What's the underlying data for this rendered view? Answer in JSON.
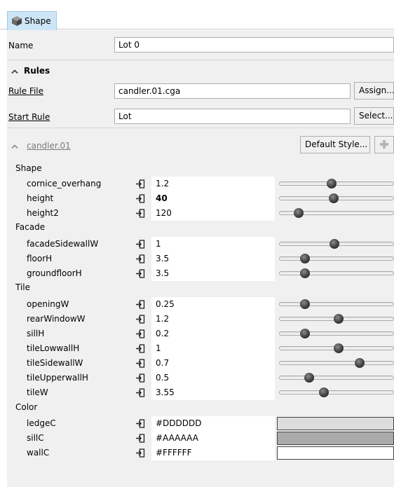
{
  "tab": {
    "label": "Shape"
  },
  "name_row": {
    "label": "Name",
    "value": "Lot 0"
  },
  "rules": {
    "title": "Rules",
    "rule_file_label": "Rule File",
    "rule_file_value": "candler.01.cga",
    "assign_label": "Assign...",
    "start_rule_label": "Start Rule",
    "start_rule_value": "Lot",
    "select_label": "Select..."
  },
  "cga": {
    "title": "candler.01",
    "default_style_label": "Default Style...",
    "add_icon": "plus-icon"
  },
  "groups": [
    {
      "name": "Shape"
    },
    {
      "name": "Facade"
    },
    {
      "name": "Tile"
    },
    {
      "name": "Color"
    }
  ],
  "attributes": {
    "cornice_overhang": {
      "name": "cornice_overhang",
      "value": "1.2",
      "level": 0.45
    },
    "height": {
      "name": "height",
      "value": "40",
      "level": 0.47
    },
    "height2": {
      "name": "height2",
      "value": "120",
      "level": 0.14
    },
    "facadeSidewallW": {
      "name": "facadeSidewallW",
      "value": "1",
      "level": 0.48
    },
    "floorH": {
      "name": "floorH",
      "value": "3.5",
      "level": 0.2
    },
    "groundfloorH": {
      "name": "groundfloorH",
      "value": "3.5",
      "level": 0.2
    },
    "openingW": {
      "name": "openingW",
      "value": "0.25",
      "level": 0.2
    },
    "rearWindowW": {
      "name": "rearWindowW",
      "value": "1.2",
      "level": 0.52
    },
    "sillH": {
      "name": "sillH",
      "value": "0.2",
      "level": 0.2
    },
    "tileLowwallH": {
      "name": "tileLowwallH",
      "value": "1",
      "level": 0.52
    },
    "tileSidewallW": {
      "name": "tileSidewallW",
      "value": "0.7",
      "level": 0.72
    },
    "tileUpperwallH": {
      "name": "tileUpperwallH",
      "value": "0.5",
      "level": 0.24
    },
    "tileW": {
      "name": "tileW",
      "value": "3.55",
      "level": 0.38
    },
    "ledgeC": {
      "name": "ledgeC",
      "value": "#DDDDDD",
      "color": "#DDDDDD"
    },
    "sillC": {
      "name": "sillC",
      "value": "#AAAAAA",
      "color": "#AAAAAA"
    },
    "wallC": {
      "name": "wallC",
      "value": "#FFFFFF",
      "color": "#FFFFFF"
    }
  },
  "colors": {
    "tab_bg": "#cde6f7",
    "panel_bg": "#f0f0f0"
  }
}
